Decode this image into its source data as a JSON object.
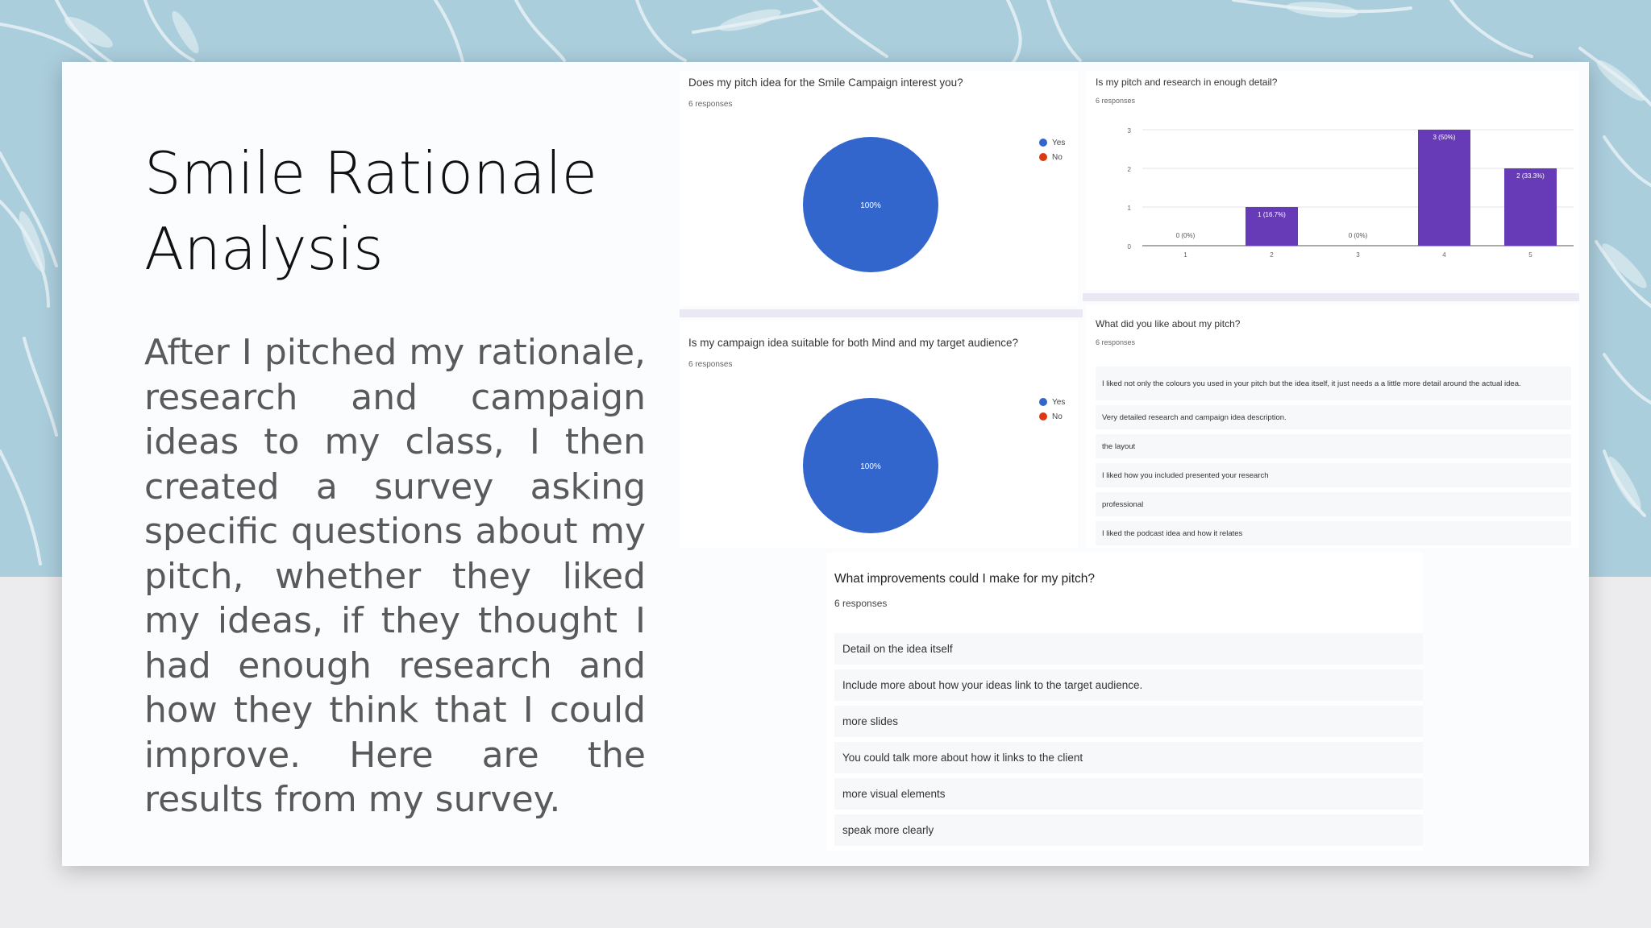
{
  "slide": {
    "title_line1": "Smile Rationale",
    "title_line2": "Analysis",
    "body": "After I pitched my rationale, research and campaign ideas to my class, I then created a survey asking specific questions about my pitch, whether they liked my ideas, if they thought I had enough research and how they think that I could improve. Here are the results from my survey."
  },
  "colors": {
    "yes": "#3366cc",
    "no": "#dc3912",
    "bar": "#673ab7",
    "sky": "#abcedd"
  },
  "q1": {
    "title": "Does my pitch idea for the Smile Campaign interest you?",
    "responses": "6 responses",
    "legend": [
      "Yes",
      "No"
    ],
    "pie_label": "100%"
  },
  "q2": {
    "title": "Is my pitch and research in enough detail?",
    "responses": "6 responses"
  },
  "q3": {
    "title": "Is my campaign idea suitable for both Mind and my target audience?",
    "responses": "6 responses",
    "legend": [
      "Yes",
      "No"
    ],
    "pie_label": "100%"
  },
  "q4": {
    "title": "What did you like about my pitch?",
    "responses": "6 responses",
    "answers": [
      "I liked not only the colours you used in your pitch but the idea itself, it just needs a a little more detail around the actual idea.",
      "Very detailed research and campaign idea description.",
      "the layout",
      "I liked how you included presented your research",
      "professional",
      "I liked the podcast idea and how it relates"
    ]
  },
  "q5": {
    "title": "What improvements could I make for my pitch?",
    "responses": "6 responses",
    "answers": [
      "Detail on the idea itself",
      "Include more about how your ideas link to the target audience.",
      "more slides",
      "You could talk more about how it links to the client",
      "more visual elements",
      "speak more clearly"
    ]
  },
  "chart_data": [
    {
      "type": "pie",
      "title": "Does my pitch idea for the Smile Campaign interest you?",
      "subtitle": "6 responses",
      "categories": [
        "Yes",
        "No"
      ],
      "values": [
        6,
        0
      ],
      "labels": [
        "100%"
      ],
      "legend": "top-right"
    },
    {
      "type": "bar",
      "title": "Is my pitch and research in enough detail?",
      "subtitle": "6 responses",
      "categories": [
        "1",
        "2",
        "3",
        "4",
        "5"
      ],
      "values": [
        0,
        1,
        0,
        3,
        2
      ],
      "data_labels": [
        "0 (0%)",
        "1 (16.7%)",
        "0 (0%)",
        "3 (50%)",
        "2 (33.3%)"
      ],
      "yticks": [
        "0",
        "1",
        "2",
        "3"
      ],
      "ylim": [
        0,
        3
      ],
      "grid": true
    },
    {
      "type": "pie",
      "title": "Is my campaign idea suitable for both Mind and my target audience?",
      "subtitle": "6 responses",
      "categories": [
        "Yes",
        "No"
      ],
      "values": [
        6,
        0
      ],
      "labels": [
        "100%"
      ],
      "legend": "top-right"
    }
  ]
}
